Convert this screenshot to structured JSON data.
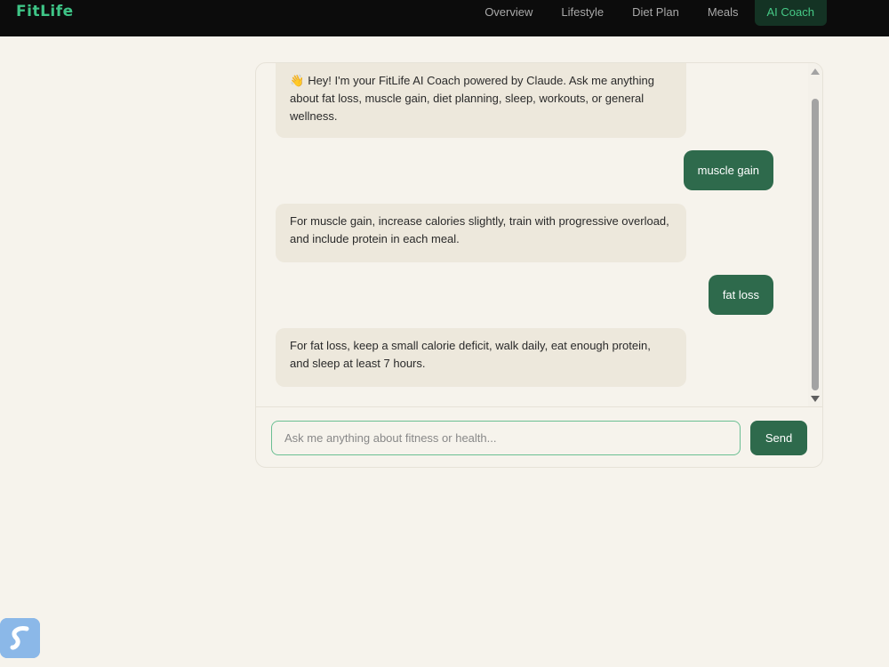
{
  "app": {
    "brand": "FitLife"
  },
  "nav": {
    "items": [
      {
        "label": "Overview"
      },
      {
        "label": "Lifestyle"
      },
      {
        "label": "Diet Plan"
      },
      {
        "label": "Meals"
      },
      {
        "label": "AI Coach",
        "active": true
      }
    ]
  },
  "chat": {
    "messages": [
      {
        "role": "bot",
        "icon": "wave-hand-icon",
        "emoji": "👋",
        "text": "Hey! I'm your FitLife AI Coach powered by Claude. Ask me anything about fat loss, muscle gain, diet planning, sleep, workouts, or general wellness."
      },
      {
        "role": "user",
        "text": "muscle gain"
      },
      {
        "role": "bot",
        "text": "For muscle gain, increase calories slightly, train with progressive overload, and include protein in each meal."
      },
      {
        "role": "user",
        "text": "fat loss"
      },
      {
        "role": "bot",
        "text": "For fat loss, keep a small calorie deficit, walk daily, eat enough protein, and sleep at least 7 hours."
      }
    ],
    "input": {
      "value": "",
      "placeholder": "Ask me anything about fitness or health..."
    },
    "send_label": "Send"
  },
  "colors": {
    "accent": "#2e6a4c",
    "brand_green": "#3ec486",
    "background": "#f6f3ec",
    "bot_bubble": "#ede8dc",
    "nav_bg": "#0c0c0c"
  },
  "widget": {
    "icon": "app-widget-icon"
  }
}
